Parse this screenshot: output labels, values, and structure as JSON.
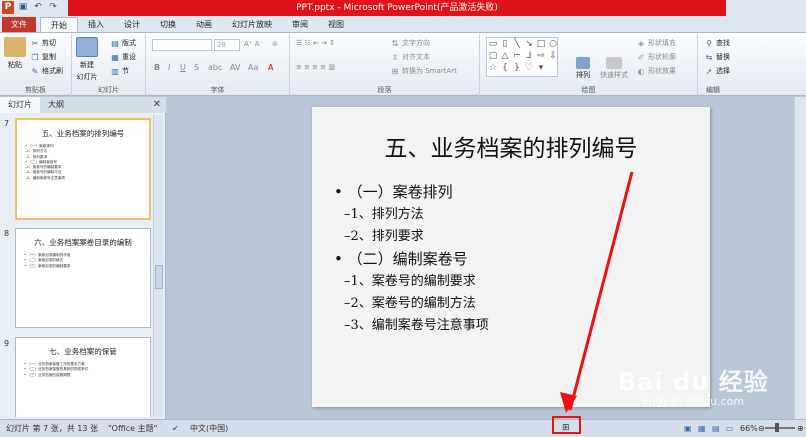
{
  "window": {
    "title": "PPT.pptx - Microsoft PowerPoint(产品激活失败)"
  },
  "tabs": [
    {
      "label": "文件"
    },
    {
      "label": "开始"
    },
    {
      "label": "插入"
    },
    {
      "label": "设计"
    },
    {
      "label": "切换"
    },
    {
      "label": "动画"
    },
    {
      "label": "幻灯片放映"
    },
    {
      "label": "审阅"
    },
    {
      "label": "视图"
    }
  ],
  "ribbon": {
    "clipboard": {
      "paste": "粘贴",
      "cut": "剪切",
      "copy": "复制",
      "format_painter": "格式刷",
      "label": "剪贴板"
    },
    "slides": {
      "new_slide": "新建",
      "new_slide2": "幻灯片",
      "layout": "版式",
      "reset": "重设",
      "section": "节",
      "label": "幻灯片"
    },
    "font": {
      "size": "28",
      "label": "字体"
    },
    "paragraph": {
      "text_direction": "文字方向",
      "align_text": "对齐文本",
      "smartart": "转换为 SmartArt",
      "label": "段落"
    },
    "drawing": {
      "arrange": "排列",
      "quick_styles": "快速样式",
      "shape_fill": "形状填充",
      "shape_outline": "形状轮廓",
      "shape_effects": "形状效果",
      "label": "绘图"
    },
    "editing": {
      "find": "查找",
      "replace": "替换",
      "select": "选择",
      "label": "编辑"
    }
  },
  "pane": {
    "tab_slides": "幻灯片",
    "tab_outline": "大纲",
    "thumbnails": [
      {
        "num": "7",
        "title": "五、业务档案的排列编号",
        "lines": [
          "• （一）案卷排列",
          "  –1、排列方法",
          "  –2、排列要求",
          "• （二）编制案卷号",
          "  –1、案卷号的编制要求",
          "  –2、案卷号的编制方法",
          "  –3、编制案卷号注意事项"
        ]
      },
      {
        "num": "8",
        "title": "六、业务档案案卷目录的编制",
        "lines": [
          "• （一）案卷目录编制的作用",
          "• （二）案卷目录的格式",
          "• （三）案卷目录的编制要求"
        ]
      },
      {
        "num": "9",
        "title": "七、业务档案的保管",
        "lines": [
          "• （一）业务档案保管工作的基本方案",
          "• （二）业务档案保管的具体的物质条件",
          "• （三）业务档案的保管期限"
        ]
      }
    ]
  },
  "slide": {
    "title": "五、业务档案的排列编号",
    "bullets": [
      {
        "level": 1,
        "text": "• （一）案卷排列"
      },
      {
        "level": 2,
        "text": "–1、排列方法"
      },
      {
        "level": 2,
        "text": "–2、排列要求"
      },
      {
        "level": 1,
        "text": "• （二）编制案卷号"
      },
      {
        "level": 2,
        "text": "–1、案卷号的编制要求"
      },
      {
        "level": 2,
        "text": "–2、案卷号的编制方法"
      },
      {
        "level": 2,
        "text": "–3、编制案卷号注意事项"
      }
    ]
  },
  "status": {
    "slide_info": "幻灯片 第 7 张，共 13 张",
    "theme": "\"Office 主题\"",
    "language": "中文(中国)",
    "zoom": "66%"
  },
  "watermark": {
    "logo": "Bai du 经验",
    "url": "jingyan.baidu.com"
  },
  "colors": {
    "file_tab": "#c4352a",
    "title_band": "#e0121a",
    "annotation": "#e11111"
  }
}
